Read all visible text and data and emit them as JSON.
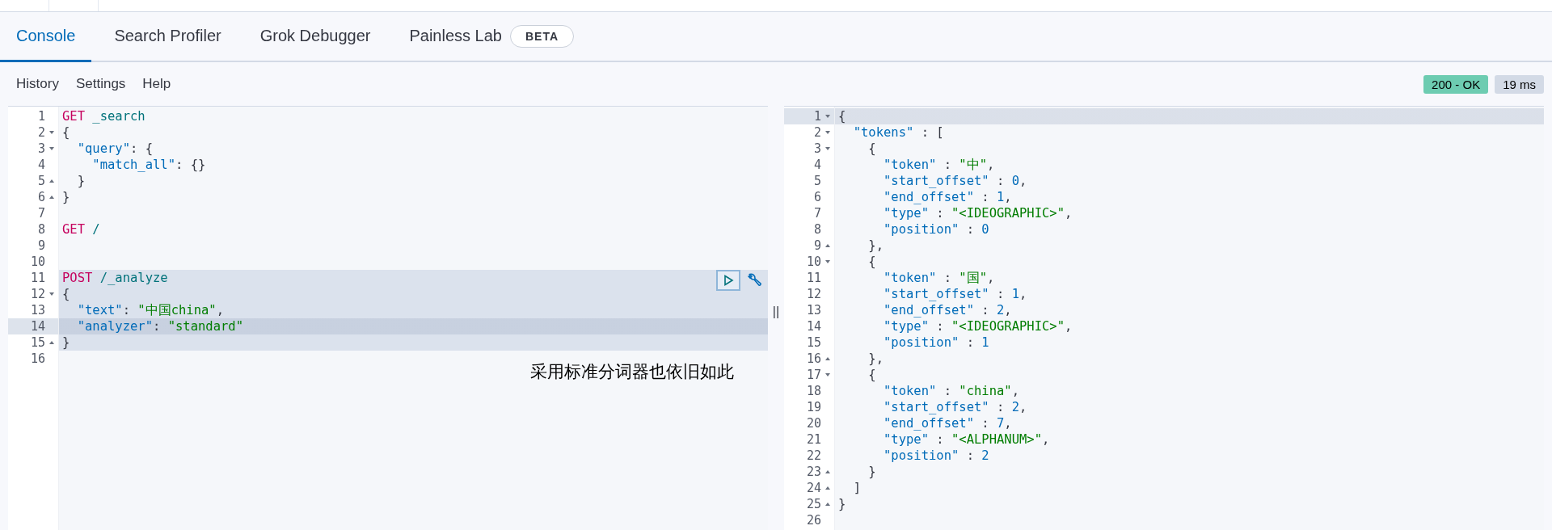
{
  "tabs": [
    {
      "label": "Console",
      "selected": true
    },
    {
      "label": "Search Profiler",
      "selected": false
    },
    {
      "label": "Grok Debugger",
      "selected": false
    },
    {
      "label": "Painless Lab",
      "selected": false,
      "badge": "BETA"
    }
  ],
  "toolbar": [
    "History",
    "Settings",
    "Help"
  ],
  "status": {
    "code": "200 - OK",
    "time": "19 ms"
  },
  "request_editor": {
    "lines": [
      {
        "number": "1",
        "fold_start": false,
        "fold_end": false,
        "in_request": false,
        "current": false,
        "tokens": [
          {
            "kind": "method",
            "text": "GET"
          },
          {
            "kind": "path",
            "text": " _search"
          }
        ]
      },
      {
        "number": "2",
        "fold_start": true,
        "fold_end": false,
        "in_request": false,
        "current": false,
        "tokens": [
          {
            "kind": "punct",
            "text": "{"
          }
        ]
      },
      {
        "number": "3",
        "fold_start": true,
        "fold_end": false,
        "in_request": false,
        "current": false,
        "tokens": [
          {
            "kind": "key",
            "text": "  \"query\""
          },
          {
            "kind": "punct",
            "text": ": {"
          }
        ]
      },
      {
        "number": "4",
        "fold_start": false,
        "fold_end": false,
        "in_request": false,
        "current": false,
        "tokens": [
          {
            "kind": "key",
            "text": "    \"match_all\""
          },
          {
            "kind": "punct",
            "text": ": {}"
          }
        ]
      },
      {
        "number": "5",
        "fold_start": false,
        "fold_end": true,
        "in_request": false,
        "current": false,
        "tokens": [
          {
            "kind": "punct",
            "text": "  }"
          }
        ]
      },
      {
        "number": "6",
        "fold_start": false,
        "fold_end": true,
        "in_request": false,
        "current": false,
        "tokens": [
          {
            "kind": "punct",
            "text": "}"
          }
        ]
      },
      {
        "number": "7",
        "fold_start": false,
        "fold_end": false,
        "in_request": false,
        "current": false
      },
      {
        "number": "8",
        "fold_start": false,
        "fold_end": false,
        "in_request": false,
        "current": false,
        "tokens": [
          {
            "kind": "method",
            "text": "GET"
          },
          {
            "kind": "path",
            "text": " /"
          }
        ]
      },
      {
        "number": "9",
        "fold_start": false,
        "fold_end": false,
        "in_request": false,
        "current": false
      },
      {
        "number": "10",
        "fold_start": false,
        "fold_end": false,
        "in_request": false,
        "current": false
      },
      {
        "number": "11",
        "fold_start": false,
        "fold_end": false,
        "in_request": true,
        "current": false,
        "tokens": [
          {
            "kind": "method",
            "text": "POST"
          },
          {
            "kind": "path",
            "text": " /_analyze"
          }
        ]
      },
      {
        "number": "12",
        "fold_start": true,
        "fold_end": false,
        "in_request": true,
        "current": false,
        "tokens": [
          {
            "kind": "punct",
            "text": "{"
          }
        ]
      },
      {
        "number": "13",
        "fold_start": false,
        "fold_end": false,
        "in_request": true,
        "current": false,
        "tokens": [
          {
            "kind": "key",
            "text": "  \"text\""
          },
          {
            "kind": "punct",
            "text": ": "
          },
          {
            "kind": "string",
            "text": "\"中国china\""
          },
          {
            "kind": "punct",
            "text": ","
          }
        ]
      },
      {
        "number": "14",
        "fold_start": false,
        "fold_end": false,
        "in_request": true,
        "current": true,
        "tokens": [
          {
            "kind": "key",
            "text": "  \"analyzer\""
          },
          {
            "kind": "punct",
            "text": ": "
          },
          {
            "kind": "string",
            "text": "\"standard\""
          }
        ]
      },
      {
        "number": "15",
        "fold_start": false,
        "fold_end": true,
        "in_request": true,
        "current": false,
        "tokens": [
          {
            "kind": "punct",
            "text": "}"
          }
        ]
      },
      {
        "number": "16",
        "fold_start": false,
        "fold_end": false,
        "in_request": false,
        "current": false
      }
    ]
  },
  "annotation": "采用标准分词器也依旧如此",
  "splitter": "||",
  "response_editor": {
    "lines": [
      {
        "number": "1",
        "fold_start": true,
        "fold_end": false,
        "in_request": false,
        "current": true,
        "tokens": [
          {
            "kind": "punct",
            "text": "{"
          }
        ]
      },
      {
        "number": "2",
        "fold_start": true,
        "fold_end": false,
        "in_request": false,
        "current": false,
        "tokens": [
          {
            "kind": "key",
            "text": "  \"tokens\""
          },
          {
            "kind": "punct",
            "text": " : ["
          }
        ]
      },
      {
        "number": "3",
        "fold_start": true,
        "fold_end": false,
        "in_request": false,
        "current": false,
        "tokens": [
          {
            "kind": "punct",
            "text": "    {"
          }
        ]
      },
      {
        "number": "4",
        "fold_start": false,
        "fold_end": false,
        "in_request": false,
        "current": false,
        "tokens": [
          {
            "kind": "key",
            "text": "      \"token\""
          },
          {
            "kind": "punct",
            "text": " : "
          },
          {
            "kind": "string",
            "text": "\"中\""
          },
          {
            "kind": "punct",
            "text": ","
          }
        ]
      },
      {
        "number": "5",
        "fold_start": false,
        "fold_end": false,
        "in_request": false,
        "current": false,
        "tokens": [
          {
            "kind": "key",
            "text": "      \"start_offset\""
          },
          {
            "kind": "punct",
            "text": " : "
          },
          {
            "kind": "number",
            "text": "0"
          },
          {
            "kind": "punct",
            "text": ","
          }
        ]
      },
      {
        "number": "6",
        "fold_start": false,
        "fold_end": false,
        "in_request": false,
        "current": false,
        "tokens": [
          {
            "kind": "key",
            "text": "      \"end_offset\""
          },
          {
            "kind": "punct",
            "text": " : "
          },
          {
            "kind": "number",
            "text": "1"
          },
          {
            "kind": "punct",
            "text": ","
          }
        ]
      },
      {
        "number": "7",
        "fold_start": false,
        "fold_end": false,
        "in_request": false,
        "current": false,
        "tokens": [
          {
            "kind": "key",
            "text": "      \"type\""
          },
          {
            "kind": "punct",
            "text": " : "
          },
          {
            "kind": "string",
            "text": "\"<IDEOGRAPHIC>\""
          },
          {
            "kind": "punct",
            "text": ","
          }
        ]
      },
      {
        "number": "8",
        "fold_start": false,
        "fold_end": false,
        "in_request": false,
        "current": false,
        "tokens": [
          {
            "kind": "key",
            "text": "      \"position\""
          },
          {
            "kind": "punct",
            "text": " : "
          },
          {
            "kind": "number",
            "text": "0"
          }
        ]
      },
      {
        "number": "9",
        "fold_start": false,
        "fold_end": true,
        "in_request": false,
        "current": false,
        "tokens": [
          {
            "kind": "punct",
            "text": "    },"
          }
        ]
      },
      {
        "number": "10",
        "fold_start": true,
        "fold_end": false,
        "in_request": false,
        "current": false,
        "tokens": [
          {
            "kind": "punct",
            "text": "    {"
          }
        ]
      },
      {
        "number": "11",
        "fold_start": false,
        "fold_end": false,
        "in_request": false,
        "current": false,
        "tokens": [
          {
            "kind": "key",
            "text": "      \"token\""
          },
          {
            "kind": "punct",
            "text": " : "
          },
          {
            "kind": "string",
            "text": "\"国\""
          },
          {
            "kind": "punct",
            "text": ","
          }
        ]
      },
      {
        "number": "12",
        "fold_start": false,
        "fold_end": false,
        "in_request": false,
        "current": false,
        "tokens": [
          {
            "kind": "key",
            "text": "      \"start_offset\""
          },
          {
            "kind": "punct",
            "text": " : "
          },
          {
            "kind": "number",
            "text": "1"
          },
          {
            "kind": "punct",
            "text": ","
          }
        ]
      },
      {
        "number": "13",
        "fold_start": false,
        "fold_end": false,
        "in_request": false,
        "current": false,
        "tokens": [
          {
            "kind": "key",
            "text": "      \"end_offset\""
          },
          {
            "kind": "punct",
            "text": " : "
          },
          {
            "kind": "number",
            "text": "2"
          },
          {
            "kind": "punct",
            "text": ","
          }
        ]
      },
      {
        "number": "14",
        "fold_start": false,
        "fold_end": false,
        "in_request": false,
        "current": false,
        "tokens": [
          {
            "kind": "key",
            "text": "      \"type\""
          },
          {
            "kind": "punct",
            "text": " : "
          },
          {
            "kind": "string",
            "text": "\"<IDEOGRAPHIC>\""
          },
          {
            "kind": "punct",
            "text": ","
          }
        ]
      },
      {
        "number": "15",
        "fold_start": false,
        "fold_end": false,
        "in_request": false,
        "current": false,
        "tokens": [
          {
            "kind": "key",
            "text": "      \"position\""
          },
          {
            "kind": "punct",
            "text": " : "
          },
          {
            "kind": "number",
            "text": "1"
          }
        ]
      },
      {
        "number": "16",
        "fold_start": false,
        "fold_end": true,
        "in_request": false,
        "current": false,
        "tokens": [
          {
            "kind": "punct",
            "text": "    },"
          }
        ]
      },
      {
        "number": "17",
        "fold_start": true,
        "fold_end": false,
        "in_request": false,
        "current": false,
        "tokens": [
          {
            "kind": "punct",
            "text": "    {"
          }
        ]
      },
      {
        "number": "18",
        "fold_start": false,
        "fold_end": false,
        "in_request": false,
        "current": false,
        "tokens": [
          {
            "kind": "key",
            "text": "      \"token\""
          },
          {
            "kind": "punct",
            "text": " : "
          },
          {
            "kind": "string",
            "text": "\"china\""
          },
          {
            "kind": "punct",
            "text": ","
          }
        ]
      },
      {
        "number": "19",
        "fold_start": false,
        "fold_end": false,
        "in_request": false,
        "current": false,
        "tokens": [
          {
            "kind": "key",
            "text": "      \"start_offset\""
          },
          {
            "kind": "punct",
            "text": " : "
          },
          {
            "kind": "number",
            "text": "2"
          },
          {
            "kind": "punct",
            "text": ","
          }
        ]
      },
      {
        "number": "20",
        "fold_start": false,
        "fold_end": false,
        "in_request": false,
        "current": false,
        "tokens": [
          {
            "kind": "key",
            "text": "      \"end_offset\""
          },
          {
            "kind": "punct",
            "text": " : "
          },
          {
            "kind": "number",
            "text": "7"
          },
          {
            "kind": "punct",
            "text": ","
          }
        ]
      },
      {
        "number": "21",
        "fold_start": false,
        "fold_end": false,
        "in_request": false,
        "current": false,
        "tokens": [
          {
            "kind": "key",
            "text": "      \"type\""
          },
          {
            "kind": "punct",
            "text": " : "
          },
          {
            "kind": "string",
            "text": "\"<ALPHANUM>\""
          },
          {
            "kind": "punct",
            "text": ","
          }
        ]
      },
      {
        "number": "22",
        "fold_start": false,
        "fold_end": false,
        "in_request": false,
        "current": false,
        "tokens": [
          {
            "kind": "key",
            "text": "      \"position\""
          },
          {
            "kind": "punct",
            "text": " : "
          },
          {
            "kind": "number",
            "text": "2"
          }
        ]
      },
      {
        "number": "23",
        "fold_start": false,
        "fold_end": true,
        "in_request": false,
        "current": false,
        "tokens": [
          {
            "kind": "punct",
            "text": "    }"
          }
        ]
      },
      {
        "number": "24",
        "fold_start": false,
        "fold_end": true,
        "in_request": false,
        "current": false,
        "tokens": [
          {
            "kind": "punct",
            "text": "  ]"
          }
        ]
      },
      {
        "number": "25",
        "fold_start": false,
        "fold_end": true,
        "in_request": false,
        "current": false,
        "tokens": [
          {
            "kind": "punct",
            "text": "}"
          }
        ]
      },
      {
        "number": "26",
        "fold_start": false,
        "fold_end": false,
        "in_request": false,
        "current": false
      }
    ]
  }
}
